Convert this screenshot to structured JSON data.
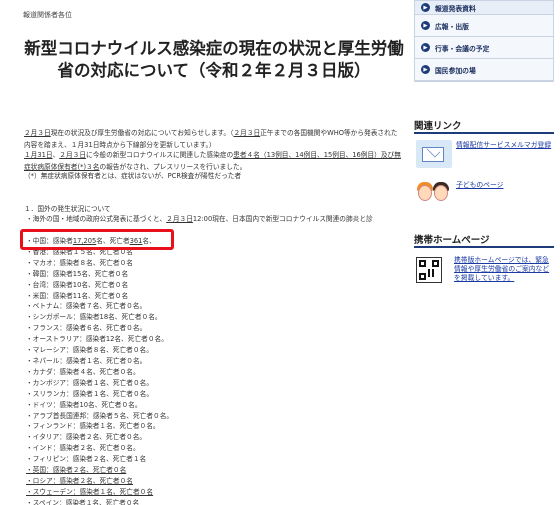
{
  "main": {
    "recipients": "報道関係者各位",
    "title": "新型コロナウイルス感染症の現在の状況と厚生労働省の対応について（令和２年２月３日版）",
    "para1_parts": [
      "",
      "２月３日",
      "現在の状況及び厚生労働省の対応についてお知らせします。（",
      "２月３日",
      "正午までの各国機関やWHO等から発表された内容を踏まえ、１月31日時点から下線部分を更新しています。）"
    ],
    "para2_parts": [
      "",
      "１月31日",
      "、",
      "２月３日",
      "に今般の新型コロナウイルスに関連した感染症の",
      "患者４名（13例目、14例目、15例目、16例目）及び無症状病原体保有者(*)３名",
      "の報告がなされ、プレスリリースを行いました。"
    ],
    "para3": "（*）無症状病原体保有者とは、症状はないが、PCR検査が陽性だった者",
    "section_heading": "１．国外の発生状況について",
    "section_sub_parts": [
      "・海外の国・地域の政府公式発表に基づくと、",
      "２月３日",
      "12:00現在、日本国内で新型コロナウイルス関連の肺炎と診"
    ],
    "countries": [
      {
        "pre": "・中国：感染者",
        "cases": "17,205",
        "mid": "名、死亡者",
        "deaths": "361",
        "post": "名、",
        "underline": false
      },
      {
        "pre": "・香港：感染者１５名、死亡者０名",
        "cases": "",
        "mid": "",
        "deaths": "",
        "post": "",
        "underline": false
      },
      {
        "pre": "・マカオ：感染者８名、死亡者０名",
        "cases": "",
        "mid": "",
        "deaths": "",
        "post": "",
        "underline": false
      },
      {
        "pre": "・韓国：感染者15名、死亡者０名",
        "cases": "",
        "mid": "",
        "deaths": "",
        "post": "",
        "underline": false
      },
      {
        "pre": "・台湾：感染者10名、死亡者０名",
        "cases": "",
        "mid": "",
        "deaths": "",
        "post": "",
        "underline": false
      },
      {
        "pre": "・米国：感染者11名、死亡者０名",
        "cases": "",
        "mid": "",
        "deaths": "",
        "post": "",
        "underline": false
      },
      {
        "pre": "・ベトナム：感染者７名、死亡者０名。",
        "cases": "",
        "mid": "",
        "deaths": "",
        "post": "",
        "underline": false
      },
      {
        "pre": "・シンガポール：感染者18名、死亡者０名。",
        "cases": "",
        "mid": "",
        "deaths": "",
        "post": "",
        "underline": false
      },
      {
        "pre": "・フランス：感染者６名、死亡者０名。",
        "cases": "",
        "mid": "",
        "deaths": "",
        "post": "",
        "underline": false
      },
      {
        "pre": "・オーストラリア：感染者12名、死亡者０名。",
        "cases": "",
        "mid": "",
        "deaths": "",
        "post": "",
        "underline": false
      },
      {
        "pre": "・マレーシア：感染者８名、死亡者０名。",
        "cases": "",
        "mid": "",
        "deaths": "",
        "post": "",
        "underline": false
      },
      {
        "pre": "・ネパール：感染者１名、死亡者０名。",
        "cases": "",
        "mid": "",
        "deaths": "",
        "post": "",
        "underline": false
      },
      {
        "pre": "・カナダ：感染者４名、死亡者０名。",
        "cases": "",
        "mid": "",
        "deaths": "",
        "post": "",
        "underline": false
      },
      {
        "pre": "・カンボジア：感染者１名、死亡者０名。",
        "cases": "",
        "mid": "",
        "deaths": "",
        "post": "",
        "underline": false
      },
      {
        "pre": "・スリランカ：感染者１名、死亡者０名。",
        "cases": "",
        "mid": "",
        "deaths": "",
        "post": "",
        "underline": false
      },
      {
        "pre": "・ドイツ：感染者10名、死亡者０名。",
        "cases": "",
        "mid": "",
        "deaths": "",
        "post": "",
        "underline": false
      },
      {
        "pre": "・アラブ首長国連邦：感染者５名、死亡者０名。",
        "cases": "",
        "mid": "",
        "deaths": "",
        "post": "",
        "underline": false
      },
      {
        "pre": "・フィンランド：感染者１名、死亡者０名。",
        "cases": "",
        "mid": "",
        "deaths": "",
        "post": "",
        "underline": false
      },
      {
        "pre": "・イタリア：感染者２名、死亡者０名。",
        "cases": "",
        "mid": "",
        "deaths": "",
        "post": "",
        "underline": false
      },
      {
        "pre": "・インド：感染者２名、死亡者０名。",
        "cases": "",
        "mid": "",
        "deaths": "",
        "post": "",
        "underline": false
      },
      {
        "pre": "・フィリピン：感染者２名、死亡者１名",
        "cases": "",
        "mid": "",
        "deaths": "",
        "post": "",
        "underline": false
      },
      {
        "pre": "・英国：感染者２名、死亡者０名",
        "cases": "",
        "mid": "",
        "deaths": "",
        "post": "",
        "underline": true
      },
      {
        "pre": "・ロシア：感染者２名、死亡者０名",
        "cases": "",
        "mid": "",
        "deaths": "",
        "post": "",
        "underline": true
      },
      {
        "pre": "・スウェーデン：感染者１名、死亡者０名",
        "cases": "",
        "mid": "",
        "deaths": "",
        "post": "",
        "underline": true
      },
      {
        "pre": "・スペイン：感染者１名、死亡者０名",
        "cases": "",
        "mid": "",
        "deaths": "",
        "post": "",
        "underline": true
      }
    ]
  },
  "sidebar": {
    "nav_items": [
      {
        "label": "報道発表資料"
      },
      {
        "label": "広報・出版"
      },
      {
        "label": "行事・会議の予定"
      },
      {
        "label": "国民参加の場"
      }
    ],
    "related_title": "関連リンク",
    "mail_link": "情報配信サービスメルマガ登録",
    "kids_link": "子どものページ",
    "mobile_title": "携帯ホームページ",
    "mobile_link": "携帯版ホームページでは、緊急情報や厚生労働省のご案内などを掲載しています。"
  },
  "colors": {
    "highlight": "#e8101a",
    "link": "#1a3aa3",
    "navy": "#1e3c7a"
  }
}
